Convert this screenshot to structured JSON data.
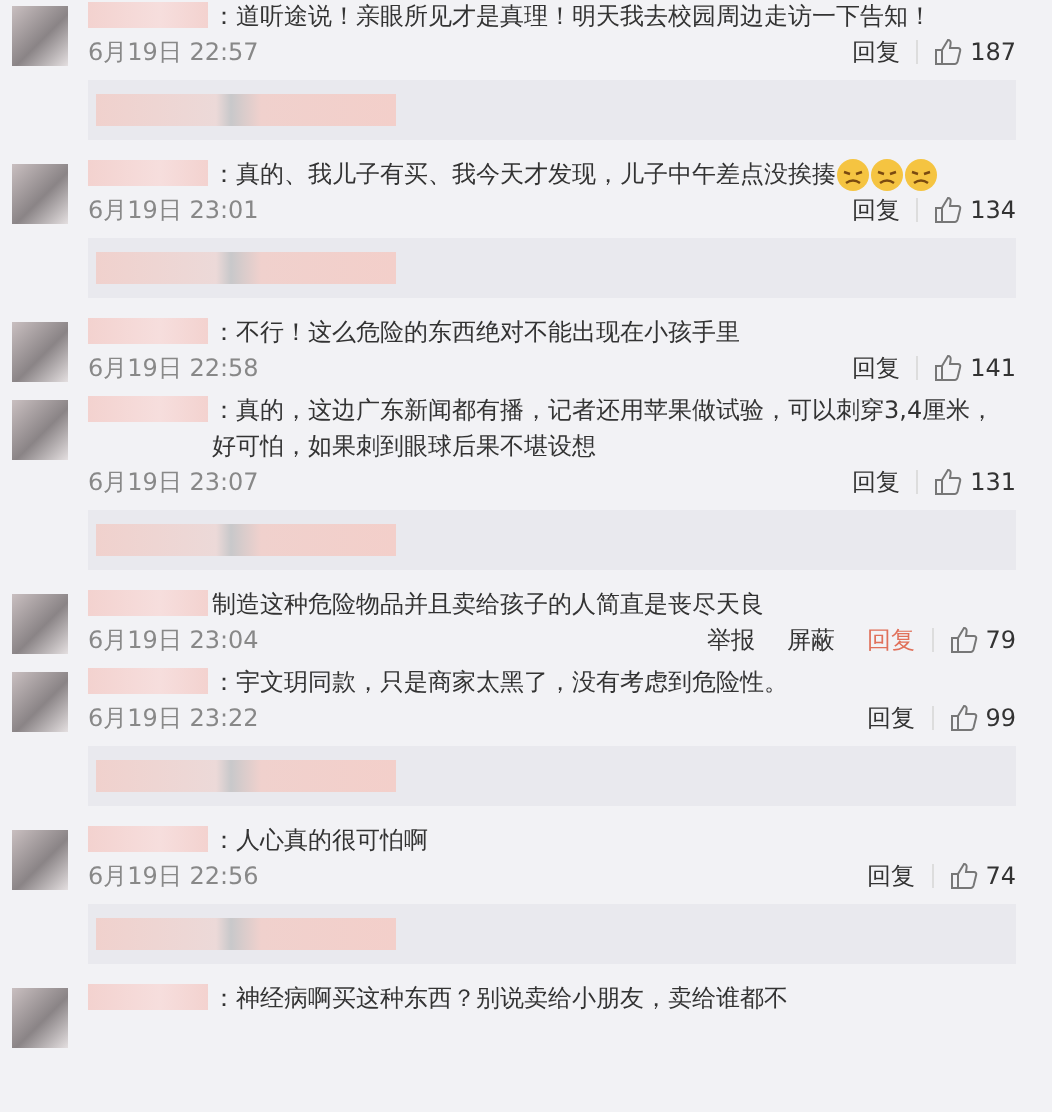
{
  "comments": [
    {
      "text": "：道听途说！亲眼所见才是真理！明天我去校园周边走访一下告知！",
      "time": "6月19日 22:57",
      "actions": [
        {
          "label": "回复",
          "highlighted": false
        }
      ],
      "likes": "187",
      "has_replies": true
    },
    {
      "text": "：真的、我儿子有买、我今天才发现，儿子中午差点没挨揍",
      "emojis": [
        {
          "kind": "worried-face"
        },
        {
          "kind": "worried-face"
        },
        {
          "kind": "worried-face"
        }
      ],
      "time": "6月19日 23:01",
      "actions": [
        {
          "label": "回复",
          "highlighted": false
        }
      ],
      "likes": "134",
      "has_replies": true
    },
    {
      "text": "：不行！这么危险的东西绝对不能出现在小孩手里",
      "time": "6月19日 22:58",
      "actions": [
        {
          "label": "回复",
          "highlighted": false
        }
      ],
      "likes": "141",
      "has_replies": false
    },
    {
      "text": "：真的，这边广东新闻都有播，记者还用苹果做试验，可以刺穿3,4厘米，好可怕，如果刺到眼球后果不堪设想",
      "time": "6月19日 23:07",
      "actions": [
        {
          "label": "回复",
          "highlighted": false
        }
      ],
      "likes": "131",
      "has_replies": true
    },
    {
      "text": "制造这种危险物品并且卖给孩子的人简直是丧尽天良",
      "time": "6月19日 23:04",
      "actions": [
        {
          "label": "举报",
          "highlighted": false
        },
        {
          "label": "屏蔽",
          "highlighted": false
        },
        {
          "label": "回复",
          "highlighted": true
        }
      ],
      "likes": "79",
      "has_replies": false
    },
    {
      "text": "：宇文玥同款，只是商家太黑了，没有考虑到危险性。",
      "time": "6月19日 23:22",
      "actions": [
        {
          "label": "回复",
          "highlighted": false
        }
      ],
      "likes": "99",
      "has_replies": true
    },
    {
      "text": "：人心真的很可怕啊",
      "time": "6月19日 22:56",
      "actions": [
        {
          "label": "回复",
          "highlighted": false
        }
      ],
      "likes": "74",
      "has_replies": true
    },
    {
      "text": "：神经病啊买这种东西？别说卖给小朋友，卖给谁都不"
    }
  ]
}
